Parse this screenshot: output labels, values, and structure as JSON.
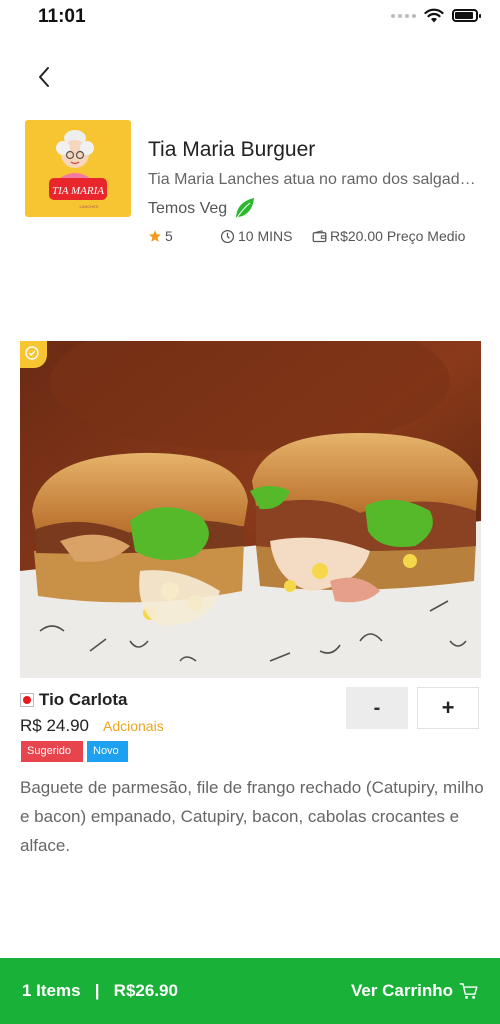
{
  "status_bar": {
    "time": "11:01"
  },
  "restaurant": {
    "name": "Tia Maria Burguer",
    "description": "Tia Maria Lanches atua no ramo dos salgados e lanches",
    "veg_label": "Temos Veg",
    "rating": "5",
    "time": "10 MINS",
    "price_avg": "R$20.00 Preço Medio",
    "logo_text": "TIA MARIA",
    "logo_subtext": "LANCHES"
  },
  "product": {
    "name": "Tio Carlota",
    "price": "R$ 24.90",
    "extras_label": "Adcionais",
    "tags": [
      "Sugerido",
      "Novo"
    ],
    "tag_colors": {
      "sugerido": "#e8444e",
      "novo": "#1ea0f0"
    },
    "minus_label": "-",
    "plus_label": "+",
    "description": "Baguete de parmesão, file de frango rechado (Catupiry, milho e bacon) empanado, Catupiry, bacon, cabolas crocantes e alface."
  },
  "cart": {
    "summary": "1 Items   |   R$26.90",
    "action_label": "Ver Carrinho",
    "bar_color": "#1ab138"
  },
  "icons": [
    "back-arrow-icon",
    "star-icon",
    "clock-icon",
    "wallet-icon",
    "leaf-icon",
    "cart-icon",
    "wifi-icon",
    "battery-icon",
    "verified-badge-icon"
  ]
}
